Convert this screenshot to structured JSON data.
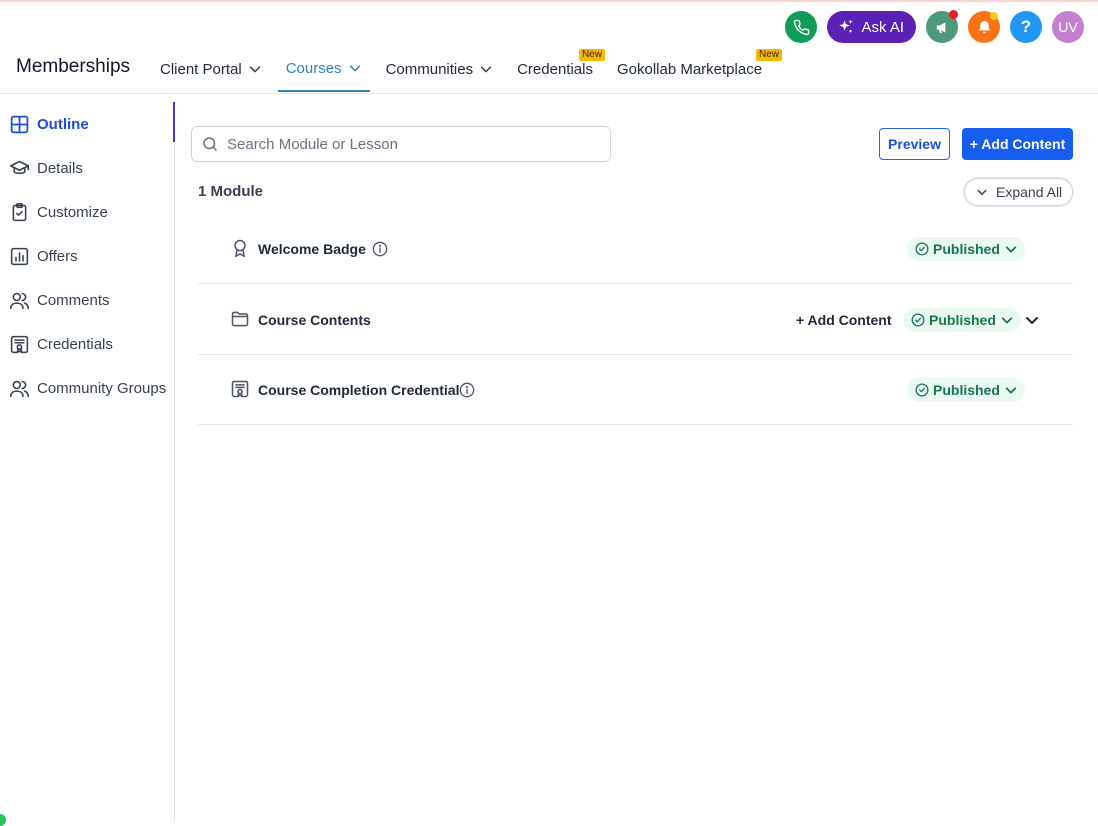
{
  "header": {
    "brand": "Memberships",
    "ask_ai_label": "Ask AI",
    "help_label": "?",
    "avatar_initials": "UV",
    "nav": [
      {
        "label": "Client Portal",
        "has_chevron": true
      },
      {
        "label": "Courses",
        "has_chevron": true,
        "active": true
      },
      {
        "label": "Communities",
        "has_chevron": true
      },
      {
        "label": "Credentials",
        "badge": "New"
      },
      {
        "label": "Gokollab Marketplace",
        "badge": "New"
      }
    ]
  },
  "sidebar": {
    "items": [
      {
        "label": "Outline",
        "icon": "grid-icon",
        "active": true
      },
      {
        "label": "Details",
        "icon": "graduation-cap-icon"
      },
      {
        "label": "Customize",
        "icon": "clipboard-check-icon"
      },
      {
        "label": "Offers",
        "icon": "bar-chart-icon"
      },
      {
        "label": "Comments",
        "icon": "users-icon"
      },
      {
        "label": "Credentials",
        "icon": "certificate-icon"
      },
      {
        "label": "Community Groups",
        "icon": "users-icon"
      }
    ]
  },
  "main": {
    "search_placeholder": "Search Module or Lesson",
    "preview_label": "Preview",
    "add_content_label": "+ Add Content",
    "module_count": "1 Module",
    "expand_all_label": "Expand All",
    "rows": [
      {
        "title": "Welcome Badge",
        "icon": "award-icon",
        "has_info": true,
        "status": "Published"
      },
      {
        "title": "Course Contents",
        "icon": "folder-icon",
        "add_label": "+ Add Content",
        "status": "Published",
        "expandable": true
      },
      {
        "title": "Course Completion Credential",
        "icon": "certificate-icon",
        "has_info": true,
        "status": "Published"
      }
    ]
  },
  "colors": {
    "accent": "#155eef",
    "active_tab": "#2e86c1",
    "published_bg": "#ebfaf1",
    "published_text": "#16794c",
    "ask_ai": "#5b21b6"
  }
}
